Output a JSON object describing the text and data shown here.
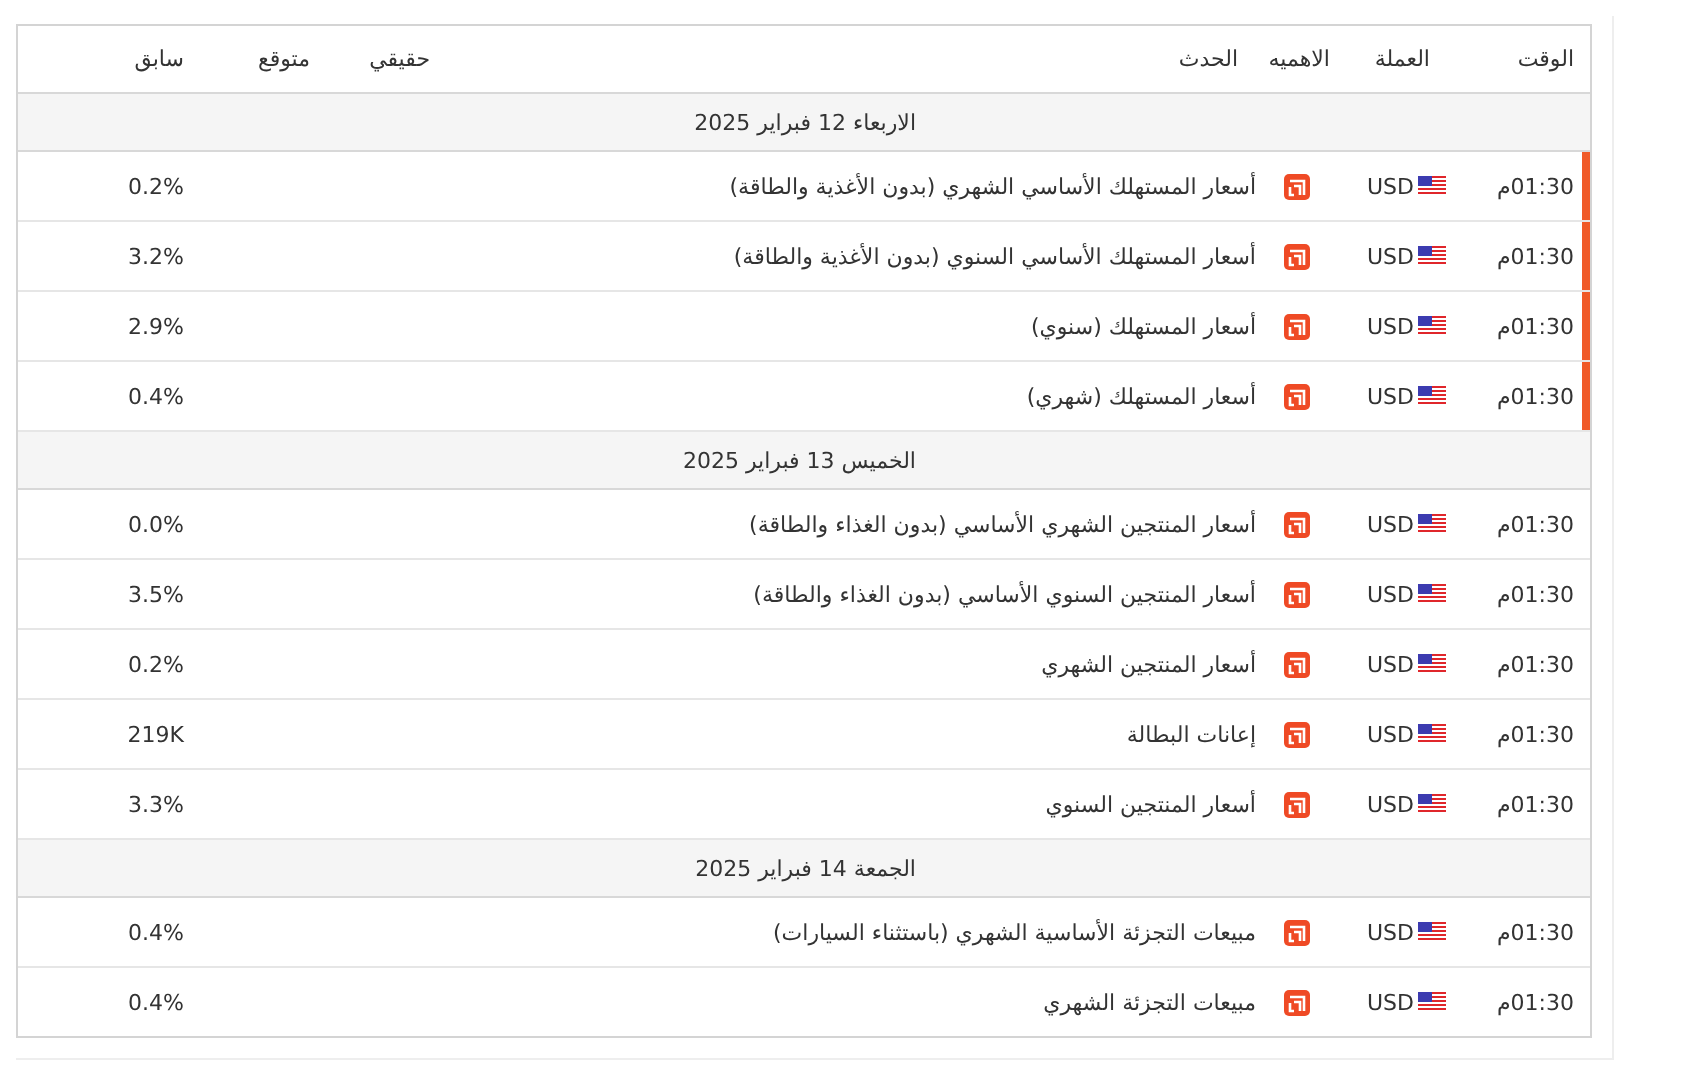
{
  "table": {
    "columns": [
      "الوقت",
      "العملة",
      "الاهميه",
      "الحدث",
      "حقيقي",
      "متوقع",
      "سابق"
    ],
    "groups": [
      {
        "date": "الاربعاء 12 فبراير 2025",
        "events": [
          {
            "time": "01:30م",
            "currency": "USD",
            "event": "أسعار المستهلك الأساسي الشهري (بدون الأغذية والطاقة)",
            "previous": "0.2%",
            "marked": true
          },
          {
            "time": "01:30م",
            "currency": "USD",
            "event": "أسعار المستهلك الأساسي السنوي (بدون الأغذية والطاقة)",
            "previous": "3.2%",
            "marked": true
          },
          {
            "time": "01:30م",
            "currency": "USD",
            "event": "أسعار المستهلك (سنوي)",
            "previous": "2.9%",
            "marked": true
          },
          {
            "time": "01:30م",
            "currency": "USD",
            "event": "أسعار المستهلك (شهري)",
            "previous": "0.4%",
            "marked": true
          }
        ]
      },
      {
        "date": "الخميس 13 فبراير 2025",
        "events": [
          {
            "time": "01:30م",
            "currency": "USD",
            "event": "أسعار المنتجين الشهري الأساسي (بدون الغذاء والطاقة)",
            "previous": "0.0%",
            "marked": false
          },
          {
            "time": "01:30م",
            "currency": "USD",
            "event": "أسعار المنتجين السنوي الأساسي (بدون الغذاء والطاقة)",
            "previous": "3.5%",
            "marked": false
          },
          {
            "time": "01:30م",
            "currency": "USD",
            "event": "أسعار المنتجين الشهري",
            "previous": "0.2%",
            "marked": false
          },
          {
            "time": "01:30م",
            "currency": "USD",
            "event": "إعانات البطالة",
            "previous": "219K",
            "marked": false
          },
          {
            "time": "01:30م",
            "currency": "USD",
            "event": "أسعار المنتجين السنوي",
            "previous": "3.3%",
            "marked": false
          }
        ]
      },
      {
        "date": "الجمعة 14 فبراير 2025",
        "events": [
          {
            "time": "01:30م",
            "currency": "USD",
            "event": "مبيعات التجزئة الأساسية الشهري (باستثناء السيارات)",
            "previous": "0.4%",
            "marked": false
          },
          {
            "time": "01:30م",
            "currency": "USD",
            "event": "مبيعات التجزئة الشهري",
            "previous": "0.4%",
            "marked": false
          }
        ]
      }
    ]
  }
}
